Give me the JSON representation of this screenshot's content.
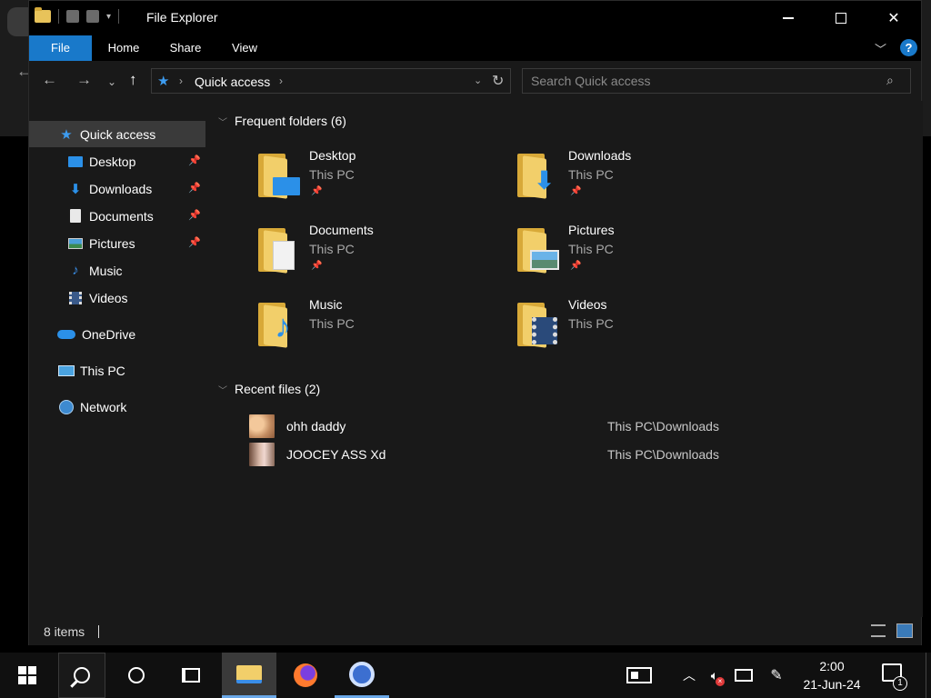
{
  "window": {
    "title": "File Explorer",
    "minimize_label": "—",
    "close_label": "✕"
  },
  "ribbon": {
    "tabs": [
      "File",
      "Home",
      "Share",
      "View"
    ],
    "help_label": "?"
  },
  "address": {
    "location": "Quick access",
    "search_placeholder": "Search Quick access"
  },
  "sidebar": {
    "items": [
      {
        "label": "Quick access",
        "icon": "star-icon"
      },
      {
        "label": "Desktop",
        "icon": "desktop-icon",
        "pinned": true
      },
      {
        "label": "Downloads",
        "icon": "download-icon",
        "pinned": true
      },
      {
        "label": "Documents",
        "icon": "documents-icon",
        "pinned": true
      },
      {
        "label": "Pictures",
        "icon": "pictures-icon",
        "pinned": true
      },
      {
        "label": "Music",
        "icon": "music-icon"
      },
      {
        "label": "Videos",
        "icon": "videos-icon"
      },
      {
        "label": "OneDrive",
        "icon": "onedrive-icon"
      },
      {
        "label": "This PC",
        "icon": "this-pc-icon"
      },
      {
        "label": "Network",
        "icon": "network-icon"
      }
    ]
  },
  "content": {
    "frequent_header": "Frequent folders (6)",
    "folders": [
      {
        "name": "Desktop",
        "location": "This PC",
        "pinned": true
      },
      {
        "name": "Downloads",
        "location": "This PC",
        "pinned": true
      },
      {
        "name": "Documents",
        "location": "This PC",
        "pinned": true
      },
      {
        "name": "Pictures",
        "location": "This PC",
        "pinned": true
      },
      {
        "name": "Music",
        "location": "This PC",
        "pinned": false
      },
      {
        "name": "Videos",
        "location": "This PC",
        "pinned": false
      }
    ],
    "recent_header": "Recent files (2)",
    "recent_files": [
      {
        "name": "ohh daddy",
        "path": "This PC\\Downloads"
      },
      {
        "name": "JOOCEY ASS Xd",
        "path": "This PC\\Downloads"
      }
    ]
  },
  "status": {
    "item_count": "8 items"
  },
  "taskbar": {
    "time": "2:00",
    "date": "21-Jun-24",
    "notification_count": "1"
  },
  "colors": {
    "accent": "#1979ca",
    "folder": "#f2cf6a",
    "background": "#191919"
  }
}
